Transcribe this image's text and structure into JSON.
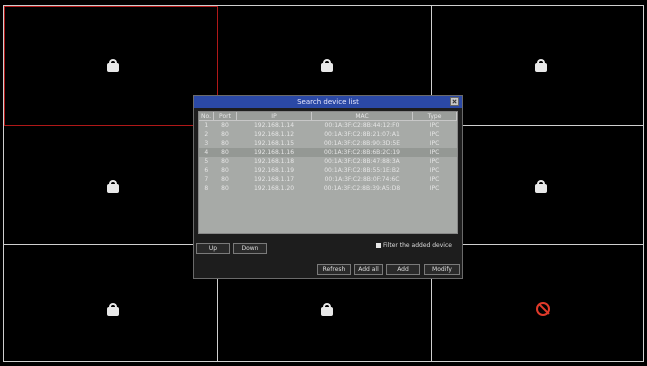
{
  "dialog": {
    "title": "Search device list",
    "columns": [
      "No.",
      "Port",
      "IP",
      "MAC",
      "Type"
    ],
    "rows": [
      {
        "no": "1",
        "port": "80",
        "ip": "192.168.1.14",
        "mac": "00:1A:3F:C2:8B:44:12:F0",
        "type": "IPC"
      },
      {
        "no": "2",
        "port": "80",
        "ip": "192.168.1.12",
        "mac": "00:1A:3F:C2:8B:21:07:A1",
        "type": "IPC"
      },
      {
        "no": "3",
        "port": "80",
        "ip": "192.168.1.15",
        "mac": "00:1A:3F:C2:8B:90:3D:5E",
        "type": "IPC"
      },
      {
        "no": "4",
        "port": "80",
        "ip": "192.168.1.16",
        "mac": "00:1A:3F:C2:8B:6B:2C:19",
        "type": "IPC"
      },
      {
        "no": "5",
        "port": "80",
        "ip": "192.168.1.18",
        "mac": "00:1A:3F:C2:8B:47:88:3A",
        "type": "IPC"
      },
      {
        "no": "6",
        "port": "80",
        "ip": "192.168.1.19",
        "mac": "00:1A:3F:C2:8B:55:1E:B2",
        "type": "IPC"
      },
      {
        "no": "7",
        "port": "80",
        "ip": "192.168.1.17",
        "mac": "00:1A:3F:C2:8B:0F:74:6C",
        "type": "IPC"
      },
      {
        "no": "8",
        "port": "80",
        "ip": "192.168.1.20",
        "mac": "00:1A:3F:C2:8B:39:A5:D8",
        "type": "IPC"
      }
    ],
    "up_label": "Up",
    "down_label": "Down",
    "filter_label": "Filter the added device",
    "refresh_label": "Refresh",
    "addall_label": "Add all",
    "add_label": "Add",
    "modify_label": "Modify"
  },
  "colors": {
    "titlebar": "#2b49a6",
    "selected_tile_border": "#b01818",
    "no_signal": "#e03a2a"
  }
}
